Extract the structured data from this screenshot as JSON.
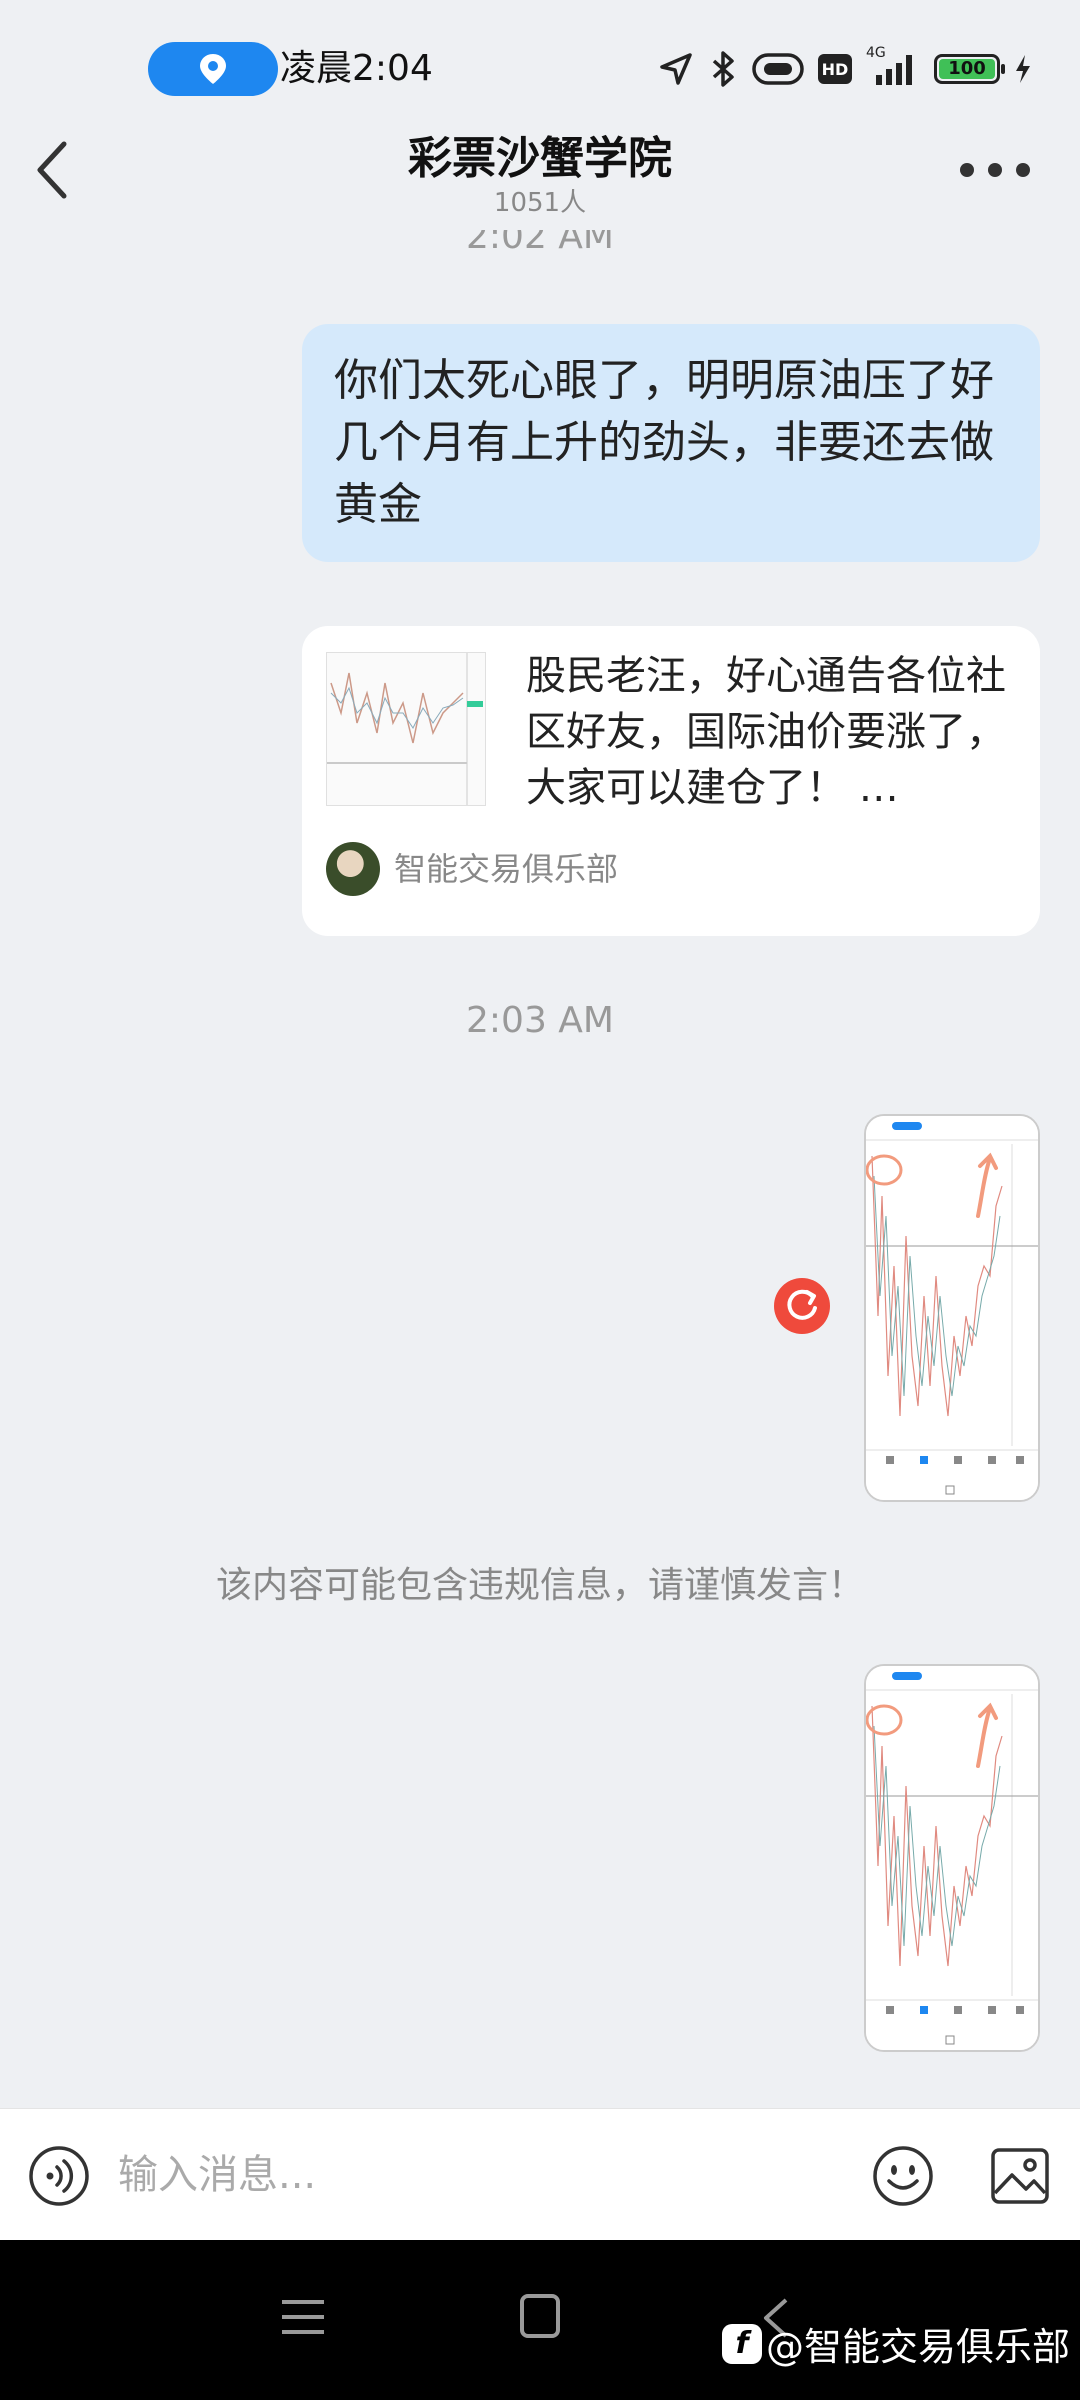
{
  "status_bar": {
    "time": "凌晨2:04",
    "network": "4G",
    "hd": "HD",
    "battery": "100"
  },
  "header": {
    "title": "彩票沙蟹学院",
    "member_count": "1051人"
  },
  "chat": {
    "time_prev_partial": "2:02 AM",
    "messages": [
      {
        "type": "text",
        "text": "你们太死心眼了，明明原油压了好几个月有上升的劲头，非要还去做黄金"
      },
      {
        "type": "share",
        "text": "股民老汪，好心通告各位社区好友，国际油价要涨了，大家可以建仓了！ …",
        "source": "智能交易俱乐部"
      }
    ],
    "time_sep": "2:03 AM",
    "warning": "该内容可能包含违规信息，请谨慎发言！"
  },
  "input": {
    "placeholder": "输入消息..."
  },
  "watermark": {
    "text": "@智能交易俱乐部"
  },
  "icons": {
    "back": "back-chevron-icon",
    "more": "more-dots-icon",
    "voice": "voice-icon",
    "emoji": "emoji-icon",
    "image": "image-icon",
    "retry": "retry-icon"
  },
  "colors": {
    "my_bubble": "#d5e9fb",
    "location_pill": "#1e87f0",
    "battery": "#40c057",
    "retry": "#ef4a3c"
  }
}
